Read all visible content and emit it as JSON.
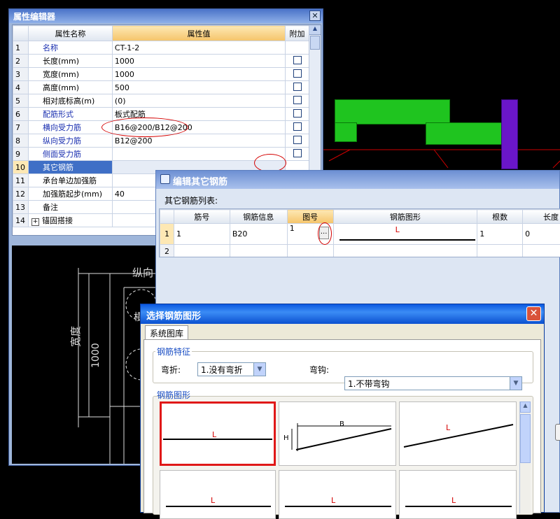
{
  "prop_editor": {
    "title": "属性编辑器",
    "close_glyph": "✕",
    "headers": {
      "name": "属性名称",
      "value": "属性值",
      "extra": "附加"
    },
    "rows": [
      {
        "num": "1",
        "name": "名称",
        "value": "CT-1-2",
        "blue": true,
        "check": false
      },
      {
        "num": "2",
        "name": "长度(mm)",
        "value": "1000",
        "blue": false,
        "check": true
      },
      {
        "num": "3",
        "name": "宽度(mm)",
        "value": "1000",
        "blue": false,
        "check": true
      },
      {
        "num": "4",
        "name": "高度(mm)",
        "value": "500",
        "blue": false,
        "check": true
      },
      {
        "num": "5",
        "name": "相对底标高(m)",
        "value": "(0)",
        "blue": false,
        "check": true
      },
      {
        "num": "6",
        "name": "配筋形式",
        "value": "板式配筋",
        "blue": true,
        "check": true
      },
      {
        "num": "7",
        "name": "横向受力筋",
        "value": "B16@200/B12@200",
        "blue": true,
        "check": true
      },
      {
        "num": "8",
        "name": "纵向受力筋",
        "value": "B12@200",
        "blue": true,
        "check": true
      },
      {
        "num": "9",
        "name": "侧面受力筋",
        "value": "",
        "blue": true,
        "check": true
      },
      {
        "num": "10",
        "name": "其它钢筋",
        "value": "",
        "blue": false,
        "check": false,
        "selected": true
      },
      {
        "num": "11",
        "name": "承台单边加强筋",
        "value": "",
        "blue": false,
        "check": false
      },
      {
        "num": "12",
        "name": "加强筋起步(mm)",
        "value": "40",
        "blue": false,
        "check": false
      },
      {
        "num": "13",
        "name": "备注",
        "value": "",
        "blue": false,
        "check": false
      },
      {
        "num": "14",
        "name": "锚固搭接",
        "value": "",
        "blue": false,
        "check": false,
        "expander": "+"
      }
    ],
    "cad": {
      "top_label": "纵向",
      "side_label": "宽度",
      "side_value": "1000",
      "inner_label": "横"
    }
  },
  "edit_dialog": {
    "title": "编辑其它钢筋",
    "list_label": "其它钢筋列表:",
    "headers": [
      "筋号",
      "钢筋信息",
      "图号",
      "钢筋图形",
      "根数",
      "长度"
    ],
    "rows": [
      {
        "num": "1",
        "bar_no": "1",
        "info": "B20",
        "fig_no": "1",
        "shape_label": "L",
        "count": "1",
        "length": "0",
        "ellipsis": "..."
      },
      {
        "num": "2",
        "bar_no": "",
        "info": "",
        "fig_no": "",
        "shape_label": "",
        "count": "",
        "length": ""
      }
    ]
  },
  "shape_dialog": {
    "title": "选择钢筋图形",
    "tab": "系统图库",
    "feature_group": "钢筋特征",
    "bend_label": "弯折:",
    "bend_value": "1.没有弯折",
    "hook_label": "弯钩:",
    "hook_value": "1.不带弯钩",
    "shape_group": "钢筋图形",
    "cell_L": "L",
    "cell_H": "H",
    "cell_B": "B"
  }
}
